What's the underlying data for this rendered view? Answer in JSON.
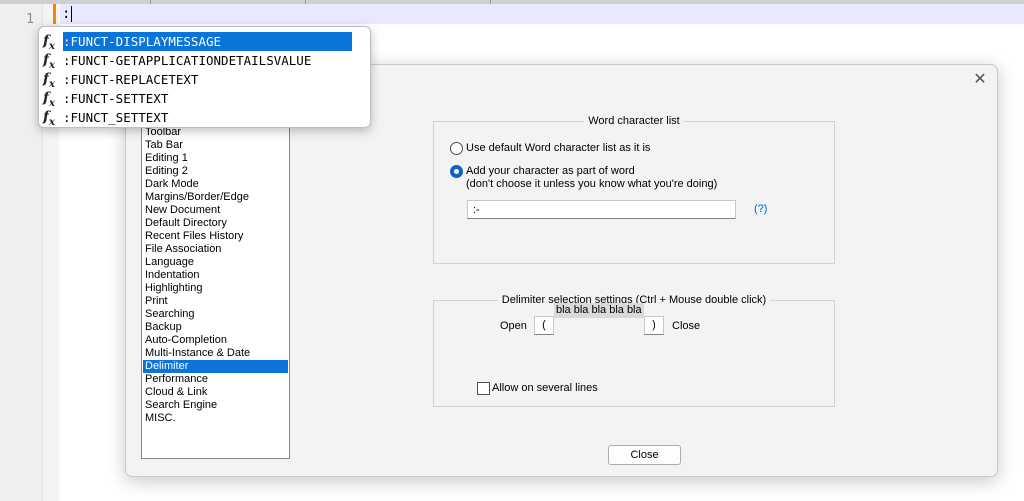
{
  "editor": {
    "line_number": "1",
    "code": ":"
  },
  "autocomplete": {
    "icon": "function-icon",
    "items": [
      ":FUNCT-DISPLAYMESSAGE",
      ":FUNCT-GETAPPLICATIONDETAILSVALUE",
      ":FUNCT-REPLACETEXT",
      ":FUNCT-SETTEXT",
      ":FUNCT_SETTEXT"
    ],
    "selected_index": 0
  },
  "dialog": {
    "close_icon": "✕",
    "categories": [
      "Toolbar",
      "Tab Bar",
      "Editing 1",
      "Editing 2",
      "Dark Mode",
      "Margins/Border/Edge",
      "New Document",
      "Default Directory",
      "Recent Files History",
      "File Association",
      "Language",
      "Indentation",
      "Highlighting",
      "Print",
      "Searching",
      "Backup",
      "Auto-Completion",
      "Multi-Instance & Date",
      "Delimiter",
      "Performance",
      "Cloud & Link",
      "Search Engine",
      "MISC."
    ],
    "selected_category": "Delimiter",
    "word_chars": {
      "title": "Word character list",
      "option_default": "Use default Word character list as it is",
      "option_add": "Add your character as part of word",
      "option_add_note": "(don't choose it unless you know what you're doing)",
      "selected_option": "add",
      "chars_value": ":-",
      "help_link": "(?)"
    },
    "delimiter": {
      "title": "Delimiter selection settings (Ctrl + Mouse double click)",
      "open_label": "Open",
      "open_value": "(",
      "sample_text": "bla bla bla bla bla",
      "close_value": ")",
      "close_label": "Close",
      "allow_several_lines_label": "Allow on several lines",
      "allow_several_lines_checked": false
    },
    "close_button": "Close"
  }
}
